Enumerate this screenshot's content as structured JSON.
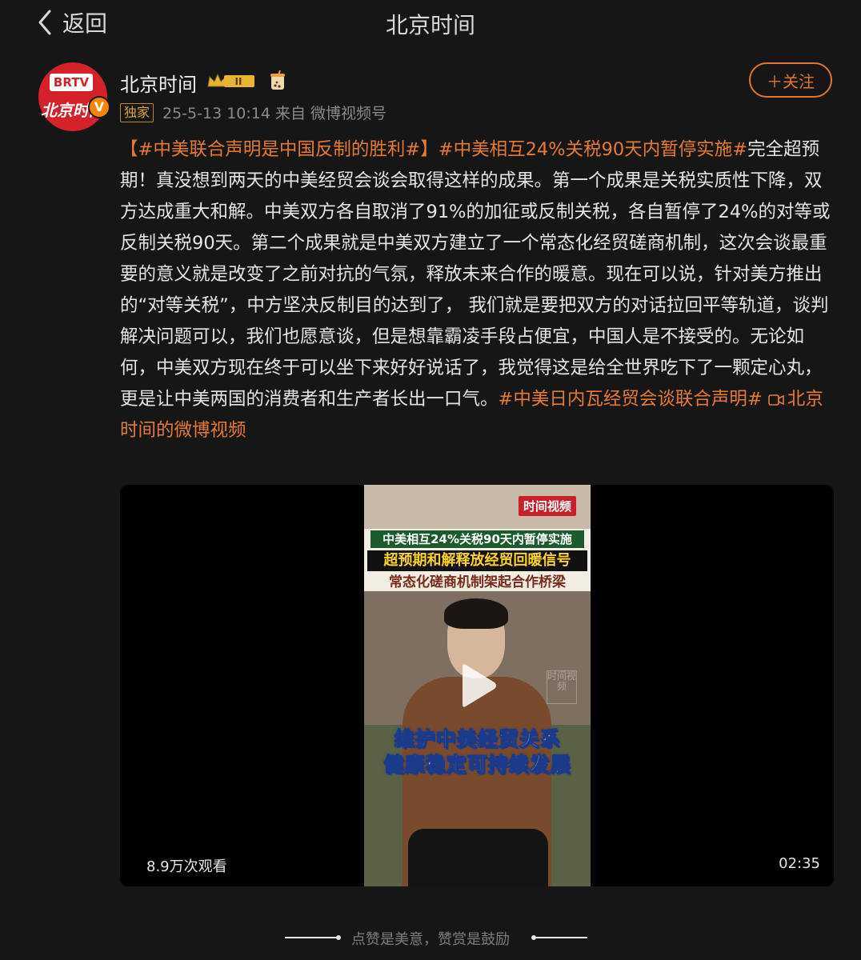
{
  "nav": {
    "back_label": "返回",
    "title": "北京时间"
  },
  "author": {
    "avatar_badge": "BRTV",
    "avatar_text": "北京时间",
    "verified_mark": "V",
    "name": "北京时间",
    "level_badge": "II",
    "exclusive_tag": "独家",
    "meta": "25-5-13 10:14  来自 微博视频号",
    "follow_label": "＋关注"
  },
  "post": {
    "tag1": "【#中美联合声明是中国反制的胜利#】",
    "tag2": "#中美相互24%关税90天内暂停实施#",
    "body": "完全超预期！真没想到两天的中美经贸会谈会取得这样的成果。第一个成果是关税实质性下降，双方达成重大和解。中美双方各自取消了91%的加征或反制关税，各自暂停了24%的对等或反制关税90天。第二个成果就是中美双方建立了一个常态化经贸磋商机制，这次会谈最重要的意义就是改变了之前对抗的气氛，释放未来合作的暖意。现在可以说，针对美方推出的“对等关税”，中方坚决反制目的达到了， 我们就是要把双方的对话拉回平等轨道，谈判解决问题可以，我们也愿意谈，但是想靠霸凌手段占便宜，中国人是不接受的。无论如何，中美双方现在终于可以坐下来好好说话了，我觉得这是给全世界吃下了一颗定心丸，更是让中美两国的消费者和生产者长出一口气。",
    "tag3": "#中美日内瓦经贸会谈联合声明#",
    "video_link": "北京时间的微博视频"
  },
  "video": {
    "channel_logo": "时间视频",
    "headline1": "中美相互24%关税90天内暂停实施",
    "headline2": "超预期和解释放经贸回暖信号",
    "headline3": "常态化磋商机制架起合作桥梁",
    "watermark": "时间视频",
    "caption1": "维护中美经贸关系",
    "caption2": "健康稳定可持续发展",
    "views": "8.9万次观看",
    "duration": "02:35"
  },
  "footer": {
    "text": "点赞是美意，赞赏是鼓励"
  },
  "colors": {
    "background": "#161616",
    "accent": "#e57a30",
    "verified": "#ff8200",
    "brand_red": "#d4212a"
  }
}
